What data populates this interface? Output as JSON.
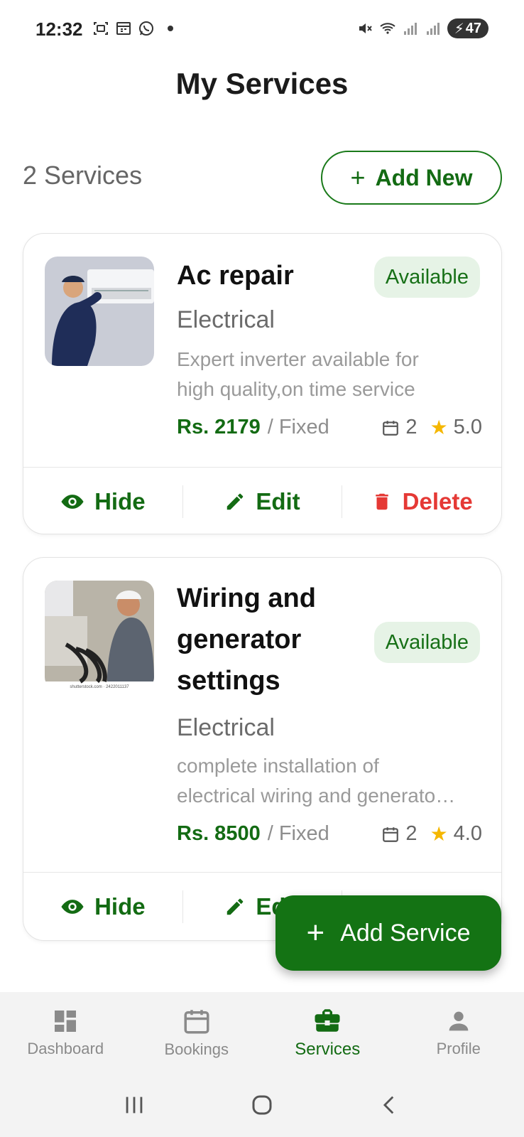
{
  "status_bar": {
    "time": "12:32",
    "battery": "47"
  },
  "header": {
    "title": "My Services"
  },
  "summary": {
    "count_label": "2 Services",
    "add_new_label": "Add New"
  },
  "services": [
    {
      "title": "Ac repair",
      "status": "Available",
      "category": "Electrical",
      "description_line1": "Expert inverter available for",
      "description_line2": "high quality,on time service",
      "price": "Rs. 2179",
      "price_type": "/ Fixed",
      "bookings": "2",
      "rating": "5.0",
      "actions": {
        "hide": "Hide",
        "edit": "Edit",
        "delete": "Delete"
      }
    },
    {
      "title_line1": "Wiring and",
      "title_line2": "generator",
      "title_line3": "settings",
      "status": "Available",
      "category": "Electrical",
      "description_line1": "complete installation of",
      "description_line2": "electrical wiring and generato…",
      "price": "Rs. 8500",
      "price_type": "/ Fixed",
      "bookings": "2",
      "rating": "4.0",
      "actions": {
        "hide": "Hide",
        "edit": "Edit"
      },
      "image_caption": "shutterstock.com · 2422011137"
    }
  ],
  "fab": {
    "label": "Add Service"
  },
  "bottom_nav": [
    {
      "label": "Dashboard",
      "icon": "dashboard-icon",
      "active": false
    },
    {
      "label": "Bookings",
      "icon": "calendar-icon",
      "active": false
    },
    {
      "label": "Services",
      "icon": "briefcase-icon",
      "active": true
    },
    {
      "label": "Profile",
      "icon": "person-icon",
      "active": false
    }
  ],
  "colors": {
    "primary": "#136b13",
    "badge_bg": "#e6f3e6",
    "danger": "#e53935",
    "star": "#f5b700"
  }
}
